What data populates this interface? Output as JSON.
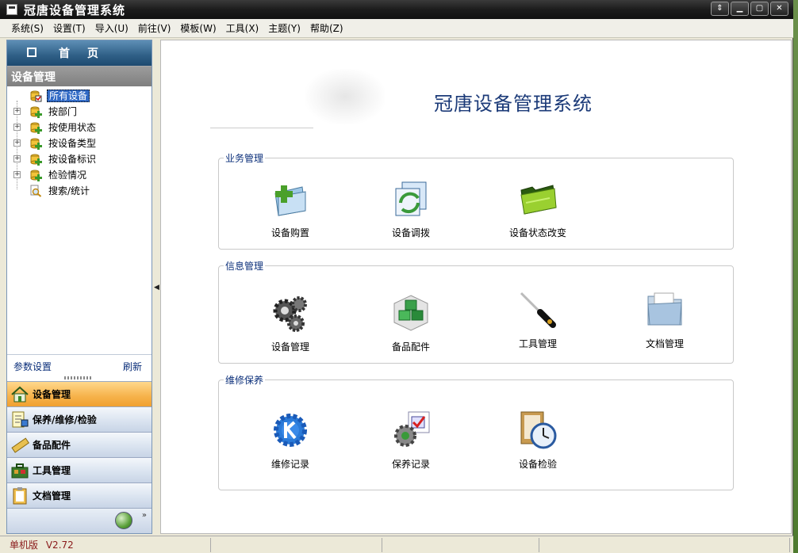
{
  "window": {
    "title": "冠唐设备管理系统"
  },
  "menu": [
    "系统(S)",
    "设置(T)",
    "导入(U)",
    "前往(V)",
    "模板(W)",
    "工具(X)",
    "主题(Y)",
    "帮助(Z)"
  ],
  "sidebar": {
    "home_label": "首页",
    "section_title": "设备管理",
    "tree": [
      {
        "label": "所有设备",
        "expandable": false,
        "selected": true
      },
      {
        "label": "按部门",
        "expandable": true,
        "selected": false
      },
      {
        "label": "按使用状态",
        "expandable": true,
        "selected": false
      },
      {
        "label": "按设备类型",
        "expandable": true,
        "selected": false
      },
      {
        "label": "按设备标识",
        "expandable": true,
        "selected": false
      },
      {
        "label": "检验情况",
        "expandable": true,
        "selected": false
      },
      {
        "label": "搜索/统计",
        "expandable": false,
        "selected": false
      }
    ],
    "footer": {
      "params_link": "参数设置",
      "refresh_link": "刷新"
    },
    "nav": [
      {
        "label": "设备管理",
        "active": true
      },
      {
        "label": "保养/维修/检验",
        "active": false
      },
      {
        "label": "备品配件",
        "active": false
      },
      {
        "label": "工具管理",
        "active": false
      },
      {
        "label": "文档管理",
        "active": false
      }
    ]
  },
  "main": {
    "title": "冠唐设备管理系统",
    "groups": [
      {
        "title": "业务管理",
        "tiles": [
          {
            "label": "设备购置",
            "icon": "folder-add-icon"
          },
          {
            "label": "设备调拨",
            "icon": "transfer-icon"
          },
          {
            "label": "设备状态改变",
            "icon": "green-folder-icon"
          }
        ]
      },
      {
        "title": "信息管理",
        "tiles": [
          {
            "label": "设备管理",
            "icon": "gears-icon"
          },
          {
            "label": "备品配件",
            "icon": "cubes-icon"
          },
          {
            "label": "工具管理",
            "icon": "screwdriver-icon"
          },
          {
            "label": "文档管理",
            "icon": "document-folder-icon"
          }
        ]
      },
      {
        "title": "维修保养",
        "tiles": [
          {
            "label": "维修记录",
            "icon": "repair-gear-icon"
          },
          {
            "label": "保养记录",
            "icon": "maintenance-check-icon"
          },
          {
            "label": "设备检验",
            "icon": "inspection-clock-icon"
          }
        ]
      }
    ]
  },
  "status": {
    "edition": "单机版",
    "version": "V2.72"
  }
}
